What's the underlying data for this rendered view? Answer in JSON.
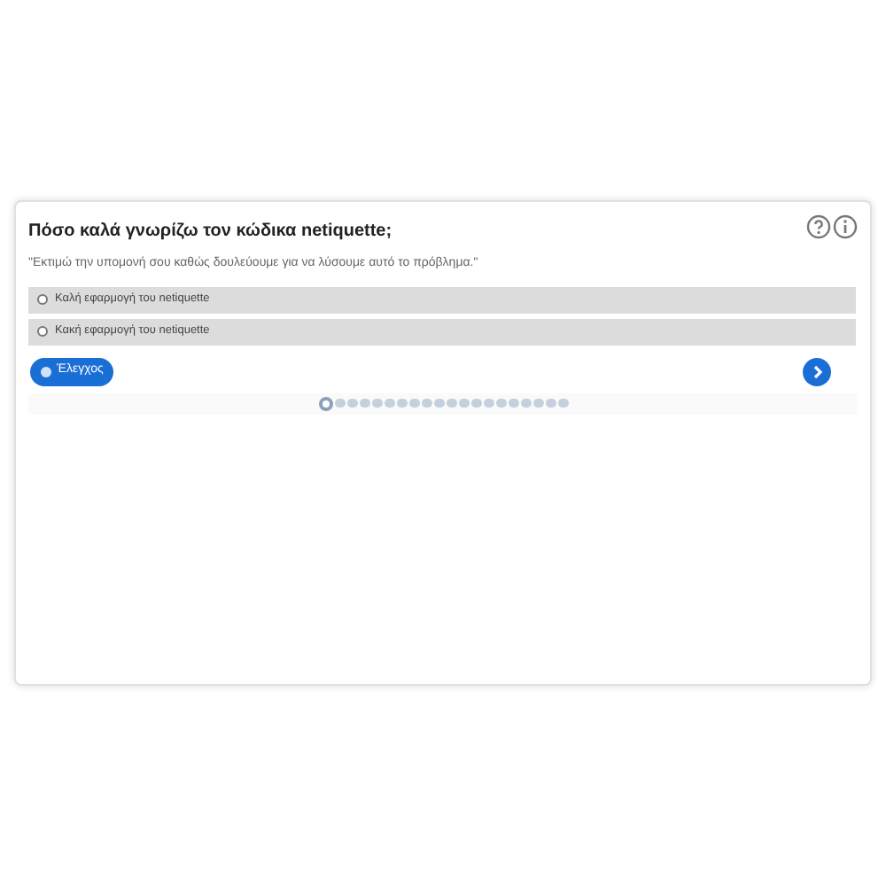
{
  "question": {
    "title": "Πόσο καλά γνωρίζω τον κώδικα netiquette;",
    "prompt": "\"Εκτιμώ την υπομονή σου καθώς δουλεύουμε για να λύσουμε αυτό το πρόβλημα.\""
  },
  "options": [
    {
      "label": "Καλή εφαρμογή του netiquette",
      "selected": false
    },
    {
      "label": "Κακή εφαρμογή του netiquette",
      "selected": false
    }
  ],
  "check_button": {
    "label": "Έλεγχος"
  },
  "pages": [
    {
      "selected": true
    },
    {
      "selected": false
    },
    {
      "selected": false
    },
    {
      "selected": false
    },
    {
      "selected": false
    },
    {
      "selected": false
    },
    {
      "selected": false
    },
    {
      "selected": false
    },
    {
      "selected": false
    },
    {
      "selected": false
    },
    {
      "selected": false
    },
    {
      "selected": false
    },
    {
      "selected": false
    },
    {
      "selected": false
    },
    {
      "selected": false
    },
    {
      "selected": false
    },
    {
      "selected": false
    },
    {
      "selected": false
    },
    {
      "selected": false
    },
    {
      "selected": false
    }
  ]
}
